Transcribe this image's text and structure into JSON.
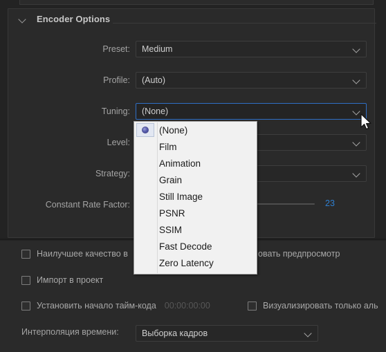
{
  "group": {
    "title": "Encoder Options",
    "twirl_icon": "chevron-down-icon"
  },
  "fields": [
    {
      "label": "Preset:",
      "value": "Medium",
      "name": "preset"
    },
    {
      "label": "Profile:",
      "value": "(Auto)",
      "name": "profile"
    },
    {
      "label": "Tuning:",
      "value": "(None)",
      "name": "tuning"
    },
    {
      "label": "Level:",
      "value": "",
      "name": "level"
    },
    {
      "label": "Strategy:",
      "value": "",
      "name": "strategy"
    }
  ],
  "crf": {
    "label": "Constant Rate Factor:",
    "value": "23",
    "value_color": "#2f7fd0"
  },
  "tuning_dropdown": {
    "selected_index": 0,
    "items": [
      "(None)",
      "Film",
      "Animation",
      "Grain",
      "Still Image",
      "PSNR",
      "SSIM",
      "Fast Decode",
      "Zero Latency"
    ]
  },
  "bottom": {
    "checkbox_best_quality": "Наилучшее качество в",
    "checkbox_best_quality_tail": "овать предпросмотр",
    "checkbox_import": "Импорт в проект",
    "checkbox_timecode": "Установить начало тайм-кода",
    "timecode_value": "00:00:00:00",
    "checkbox_alpha": "Визуализировать только аль",
    "interp_label": "Интерполяция времени:",
    "interp_value": "Выборка кадров"
  },
  "colors": {
    "panel_bg": "#2a2a2a",
    "window_bg": "#232323",
    "field_bg": "#272727",
    "focus_border": "#2f6fc6",
    "popup_bg": "#f1f1f1",
    "accent_blue": "#2f7fd0"
  },
  "cursor": {
    "icon": "mouse-pointer-icon"
  }
}
